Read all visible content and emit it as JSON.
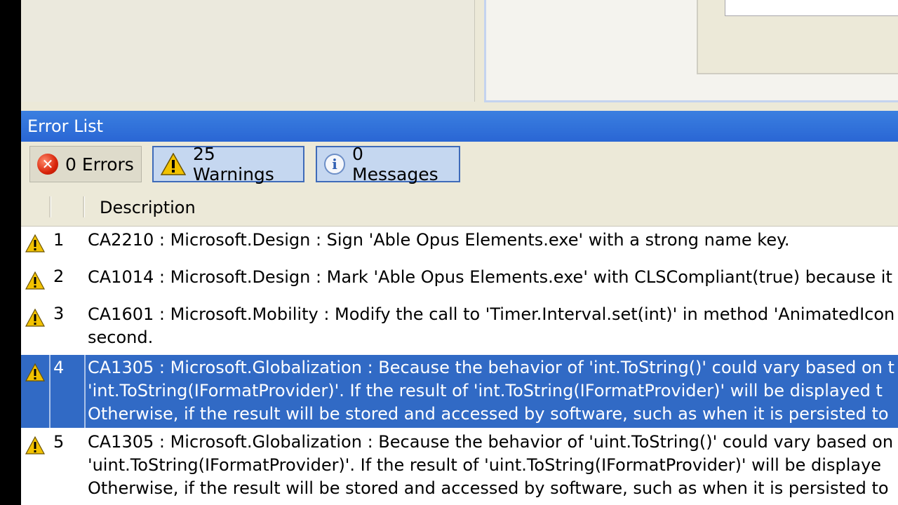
{
  "error_list": {
    "title": "Error List",
    "toolbar": {
      "errors_label": "0 Errors",
      "warnings_label": "25 Warnings",
      "messages_label": "0 Messages"
    },
    "columns": {
      "description": "Description"
    },
    "rows": [
      {
        "num": "1",
        "lines": [
          "CA2210 : Microsoft.Design : Sign 'Able Opus Elements.exe' with a strong name key."
        ]
      },
      {
        "num": "2",
        "lines": [
          "CA1014 : Microsoft.Design : Mark 'Able Opus Elements.exe' with CLSCompliant(true) because it"
        ]
      },
      {
        "num": "3",
        "lines": [
          "CA1601 : Microsoft.Mobility : Modify the call to 'Timer.Interval.set(int)' in method 'AnimatedIcon",
          "second."
        ]
      },
      {
        "num": "4",
        "selected": true,
        "lines": [
          "CA1305 : Microsoft.Globalization : Because the behavior of 'int.ToString()' could vary based on t",
          "'int.ToString(IFormatProvider)'. If the result of 'int.ToString(IFormatProvider)' will be displayed t",
          "Otherwise, if the result will be stored and accessed by software, such as when it is persisted to"
        ]
      },
      {
        "num": "5",
        "lines": [
          "CA1305 : Microsoft.Globalization : Because the behavior of 'uint.ToString()' could vary based on",
          "'uint.ToString(IFormatProvider)'. If the result of 'uint.ToString(IFormatProvider)' will be displaye",
          "Otherwise, if the result will be stored and accessed by software, such as when it is persisted to"
        ]
      }
    ]
  },
  "colors": {
    "title_bar": "#2a66d4",
    "selection": "#316ac5",
    "toolbar_bg": "#ece9d8",
    "warning_icon": "#f2c200"
  },
  "icons": {
    "errors": "error-icon",
    "warnings": "warning-icon",
    "messages": "info-icon"
  }
}
